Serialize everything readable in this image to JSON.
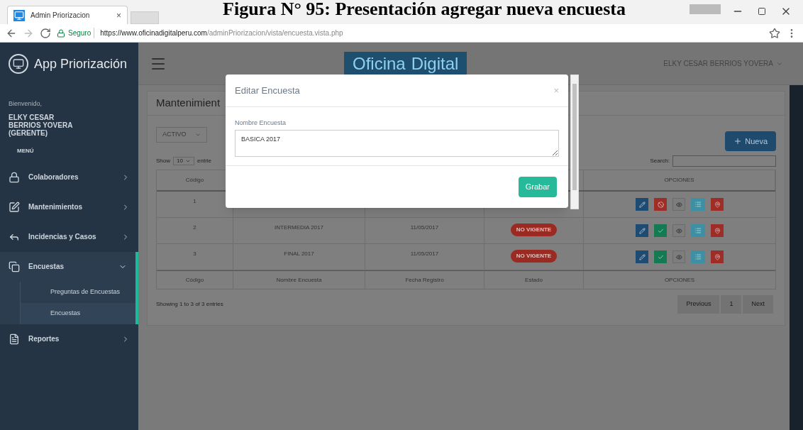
{
  "caption": "Figura N° 95: Presentación agregar nueva encuesta",
  "browser": {
    "tab_title": "Admin Priorizacion",
    "tab_close": "×",
    "secure_label": "Seguro",
    "url_host": "https://www.oficinadigitalperu.com",
    "url_path": "/adminPriorizacion/vista/encuesta.vista.php"
  },
  "sidebar": {
    "brand": "App Priorización",
    "welcome": "Bienvenido,",
    "user": "ELKY CESAR BERRIOS YOVERA (GERENTE)",
    "menu_label": "MENÚ",
    "items": [
      {
        "label": "Colaboradores",
        "expanded": false
      },
      {
        "label": "Mantenimientos",
        "expanded": false
      },
      {
        "label": "Incidencias y Casos",
        "expanded": false
      },
      {
        "label": "Encuestas",
        "expanded": true,
        "children": [
          {
            "label": "Preguntas de Encuestas",
            "selected": false
          },
          {
            "label": "Encuestas",
            "selected": true
          }
        ]
      },
      {
        "label": "Reportes",
        "expanded": false
      }
    ]
  },
  "topbar": {
    "logo_word_1": "Oficina",
    "logo_word_2": "Digital",
    "user_menu": "ELKY CESAR BERRIOS YOVERA"
  },
  "panel": {
    "title": "Mantenimient",
    "filter_value": "ACTIVO",
    "show_label": "Show",
    "page_size": "10",
    "entries_label": "entrie",
    "new_button": "Nueva",
    "search_label": "Search:",
    "header": [
      "Código",
      "OPCIONES"
    ],
    "rows": [
      {
        "codigo": "1",
        "kind": "deactivate"
      },
      {
        "codigo": "2",
        "nombre": "INTERMEDIA 2017",
        "fecha": "11/05/2017",
        "estado": "NO VIGENTE",
        "kind": "activate"
      },
      {
        "codigo": "3",
        "nombre": "FINAL 2017",
        "fecha": "11/05/2017",
        "estado": "NO VIGENTE",
        "kind": "activate"
      }
    ],
    "footer": [
      "Código",
      "Nombre Encuesta",
      "Fecha Registro",
      "Estado",
      "OPCIONES"
    ],
    "info": "Showing 1 to 3 of 3 entries",
    "pagination": [
      "Previous",
      "1",
      "Next"
    ]
  },
  "modal": {
    "title": "Editar Encuesta",
    "close": "×",
    "field_label": "Nombre Encuesta",
    "field_value": "BASICA 2017",
    "save_button": "Grabar"
  }
}
